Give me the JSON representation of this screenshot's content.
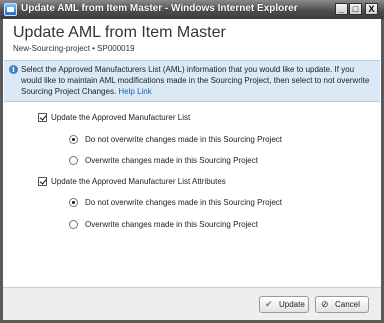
{
  "window": {
    "title": "Update AML from Item Master - Windows Internet Explorer",
    "minimize": "_",
    "maximize": "□",
    "close": "X"
  },
  "header": {
    "title": "Update AML from Item Master",
    "subtitle": "New-Sourcing-project • SP000019"
  },
  "info": {
    "icon": "info-icon",
    "text": "Select the Approved Manufacturers List (AML) information that you would like to update. If you would like to maintain AML modifications made in the Sourcing Project, then select to not overwrite Sourcing Project Changes.",
    "help_link": "Help Link"
  },
  "sections": [
    {
      "label": "Update the Approved Manufacturer List",
      "checked": true,
      "options": [
        {
          "label": "Do not overwrite changes made in this Sourcing Project",
          "selected": true
        },
        {
          "label": "Overwrite changes made in this Sourcing Project",
          "selected": false
        }
      ]
    },
    {
      "label": "Update the Approved Manufacturer List Attributes",
      "checked": true,
      "options": [
        {
          "label": "Do not overwrite changes made in this Sourcing Project",
          "selected": true
        },
        {
          "label": "Overwrite changes made in this Sourcing Project",
          "selected": false
        }
      ]
    }
  ],
  "footer": {
    "update_label": "Update",
    "update_icon": "✔",
    "cancel_label": "Cancel",
    "cancel_icon": "⊘"
  },
  "colors": {
    "info_bg": "#dbe9f6",
    "link": "#1a5fb4",
    "title_bar": "#4e4e4e"
  }
}
